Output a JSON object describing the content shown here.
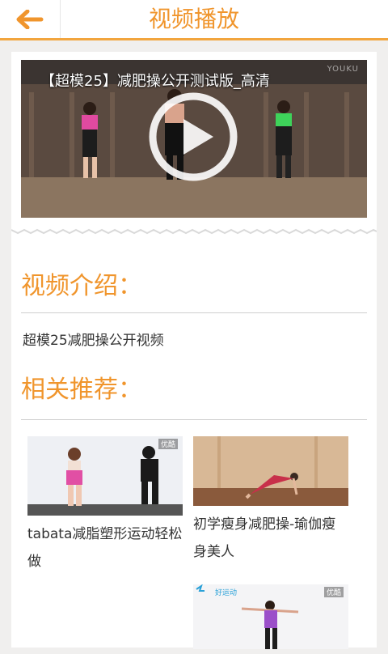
{
  "header": {
    "title": "视频播放",
    "back_icon": "arrow-left-icon"
  },
  "player": {
    "title": "【超模25】减肥操公开测试版_高清",
    "watermark": "YOUKU",
    "play_icon": "play-icon"
  },
  "intro": {
    "heading": "视频介绍：",
    "text": "超模25减肥操公开视频"
  },
  "related": {
    "heading": "相关推荐：",
    "items": [
      {
        "label": "tabata减脂塑形运动轻松做",
        "badge": "优酷"
      },
      {
        "label": "初学瘦身减肥操-瑜伽瘦身美人",
        "badge": ""
      },
      {
        "label": "",
        "badge": "优酷",
        "logo_text": "好运动"
      }
    ]
  },
  "colors": {
    "accent": "#f0952c",
    "border": "#f2a53e"
  }
}
